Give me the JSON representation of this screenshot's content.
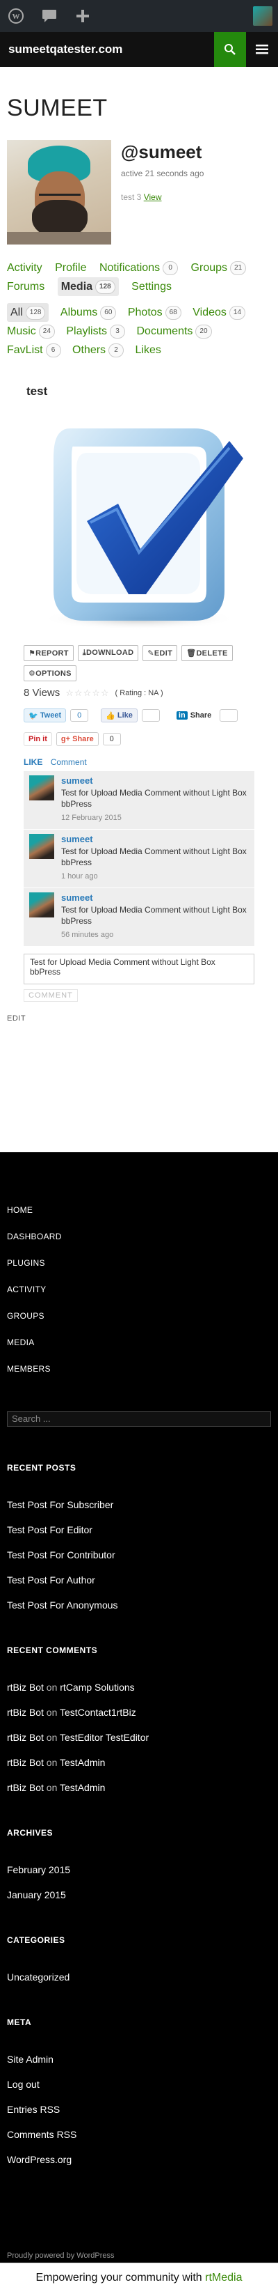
{
  "adminbar": {
    "icons": [
      "wordpress-icon",
      "comment-icon",
      "plus-icon"
    ],
    "avatar": "user-avatar"
  },
  "header": {
    "site_title": "sumeetqatester.com",
    "search_icon": "search-icon",
    "menu_icon": "hamburger-icon"
  },
  "page": {
    "title": "SUMEET"
  },
  "member": {
    "handle": "@sumeet",
    "active": "active 21 seconds ago",
    "latest_prefix": "test 3",
    "latest_link": "View"
  },
  "nav": {
    "items": [
      {
        "label": "Activity"
      },
      {
        "label": "Profile"
      },
      {
        "label": "Notifications",
        "count": "0"
      },
      {
        "label": "Groups",
        "count": "21"
      },
      {
        "label": "Forums"
      },
      {
        "label": "Media",
        "count": "128",
        "current": true
      },
      {
        "label": "Settings"
      }
    ]
  },
  "subnav": {
    "items": [
      {
        "label": "All",
        "count": "128",
        "current": true
      },
      {
        "label": "Albums",
        "count": "60"
      },
      {
        "label": "Photos",
        "count": "68"
      },
      {
        "label": "Videos",
        "count": "14"
      },
      {
        "label": "Music",
        "count": "24"
      },
      {
        "label": "Playlists",
        "count": "3"
      },
      {
        "label": "Documents",
        "count": "20"
      },
      {
        "label": "FavList",
        "count": "6"
      },
      {
        "label": "Others",
        "count": "2"
      },
      {
        "label": "Likes"
      }
    ]
  },
  "media": {
    "title": "test",
    "buttons": {
      "report": "REPORT",
      "download": "DOWNLOAD",
      "edit": "EDIT",
      "delete": "DELETE",
      "options": "OPTIONS"
    },
    "views": "8 Views",
    "rating": "( Rating : NA )"
  },
  "share": {
    "tweet": "Tweet",
    "tweet_count": "0",
    "like": "Like",
    "linkedin": "Share",
    "pin": "Pin it",
    "gplus": "Share",
    "gplus_count": "0"
  },
  "likebar": {
    "like": "LIKE",
    "comment": "Comment"
  },
  "comments": [
    {
      "author": "sumeet",
      "text": "Test for Upload Media Comment without Light Box bbPress",
      "time": "12 February 2015"
    },
    {
      "author": "sumeet",
      "text": "Test for Upload Media Comment without Light Box bbPress",
      "time": "1 hour ago"
    },
    {
      "author": "sumeet",
      "text": "Test for Upload Media Comment without Light Box bbPress",
      "time": "56 minutes ago"
    }
  ],
  "comment_form": {
    "value": "Test for Upload Media Comment without Light Box bbPress",
    "submit": "COMMENT"
  },
  "edit_link": "EDIT",
  "footer": {
    "menu": [
      "HOME",
      "DASHBOARD",
      "PLUGINS",
      "ACTIVITY",
      "GROUPS",
      "MEDIA",
      "MEMBERS"
    ],
    "search_placeholder": "Search ...",
    "recent_posts_title": "RECENT POSTS",
    "recent_posts": [
      "Test Post For Subscriber",
      "Test Post For Editor",
      "Test Post For Contributor",
      "Test Post For Author",
      "Test Post For Anonymous"
    ],
    "recent_comments_title": "RECENT COMMENTS",
    "recent_comments": [
      {
        "author": "rtBiz Bot",
        "on": "on",
        "post": "rtCamp Solutions"
      },
      {
        "author": "rtBiz Bot",
        "on": "on",
        "post": "TestContact1rtBiz"
      },
      {
        "author": "rtBiz Bot",
        "on": "on",
        "post": "TestEditor TestEditor"
      },
      {
        "author": "rtBiz Bot",
        "on": "on",
        "post": "TestAdmin"
      },
      {
        "author": "rtBiz Bot",
        "on": "on",
        "post": "TestAdmin"
      }
    ],
    "archives_title": "ARCHIVES",
    "archives": [
      "February 2015",
      "January 2015"
    ],
    "categories_title": "CATEGORIES",
    "categories": [
      "Uncategorized"
    ],
    "meta_title": "META",
    "meta": [
      "Site Admin",
      "Log out",
      "Entries RSS",
      "Comments RSS",
      "WordPress.org"
    ],
    "powered": "Proudly powered by WordPress"
  },
  "bottombar": {
    "text": "Empowering your community with",
    "brand": "rtMedia"
  }
}
